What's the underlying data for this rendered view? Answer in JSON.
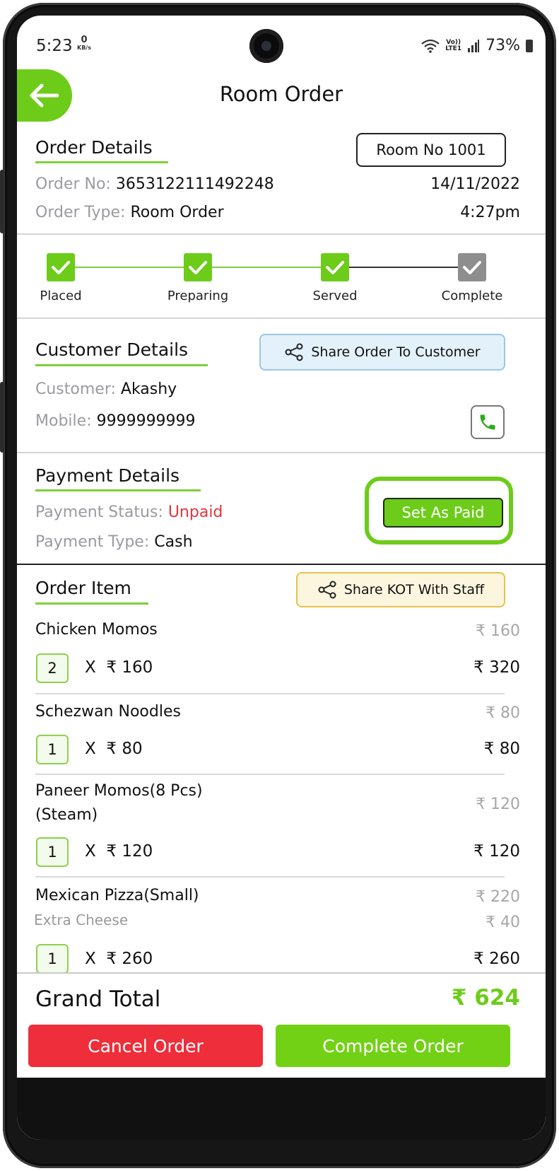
{
  "status_bar": {
    "time": "5:23",
    "net_speed_value": "0",
    "net_speed_unit": "KB/s",
    "volte_top": "Vo))",
    "volte_bottom": "LTE1",
    "battery": "73%"
  },
  "header": {
    "title": "Room Order"
  },
  "order_details": {
    "section_title": "Order Details",
    "room_badge": "Room No 1001",
    "order_no_label": "Order No:",
    "order_no": "3653122111492248",
    "date": "14/11/2022",
    "order_type_label": "Order Type:",
    "order_type": "Room Order",
    "time": "4:27pm"
  },
  "progress": {
    "steps": [
      {
        "label": "Placed",
        "done": true
      },
      {
        "label": "Preparing",
        "done": true
      },
      {
        "label": "Served",
        "done": true
      },
      {
        "label": "Complete",
        "done": false
      }
    ],
    "colors": {
      "done": "#6dcc1a",
      "pending": "#8e8e8e"
    }
  },
  "customer_details": {
    "section_title": "Customer Details",
    "share_label": "Share Order To Customer",
    "customer_label": "Customer:",
    "customer": "Akashy",
    "mobile_label": "Mobile:",
    "mobile": "9999999999"
  },
  "payment_details": {
    "section_title": "Payment Details",
    "status_label": "Payment Status:",
    "status": "Unpaid",
    "type_label": "Payment Type:",
    "type": "Cash",
    "set_paid_label": "Set As Paid"
  },
  "order_items": {
    "section_title": "Order Item",
    "share_kot_label": "Share KOT With Staff",
    "items": [
      {
        "name": "Chicken Momos",
        "price": "₹ 160",
        "qty": "2",
        "x": "X",
        "unit": "₹ 160",
        "total": "₹ 320"
      },
      {
        "name": "Schezwan Noodles",
        "price": "₹ 80",
        "qty": "1",
        "x": "X",
        "unit": "₹ 80",
        "total": "₹ 80"
      },
      {
        "name": "Paneer Momos(8 Pcs)",
        "name2": "(Steam)",
        "price": "₹ 120",
        "qty": "1",
        "x": "X",
        "unit": "₹ 120",
        "total": "₹ 120"
      },
      {
        "name": "Mexican Pizza(Small)",
        "addon": "Extra Cheese",
        "price": "₹ 220",
        "addon_price": "₹ 40",
        "qty": "1",
        "x": "X",
        "unit": "₹ 260",
        "total": "₹ 260"
      }
    ]
  },
  "footer": {
    "grand_total_label": "Grand Total",
    "grand_total": "₹ 624",
    "cancel_label": "Cancel Order",
    "complete_label": "Complete Order"
  },
  "colors": {
    "accent": "#6dcc1a",
    "danger": "#ee2e3a",
    "unpaid": "#e0363e",
    "share_customer_bg": "#e3f1fb",
    "share_kot_bg": "#fdf6df"
  }
}
